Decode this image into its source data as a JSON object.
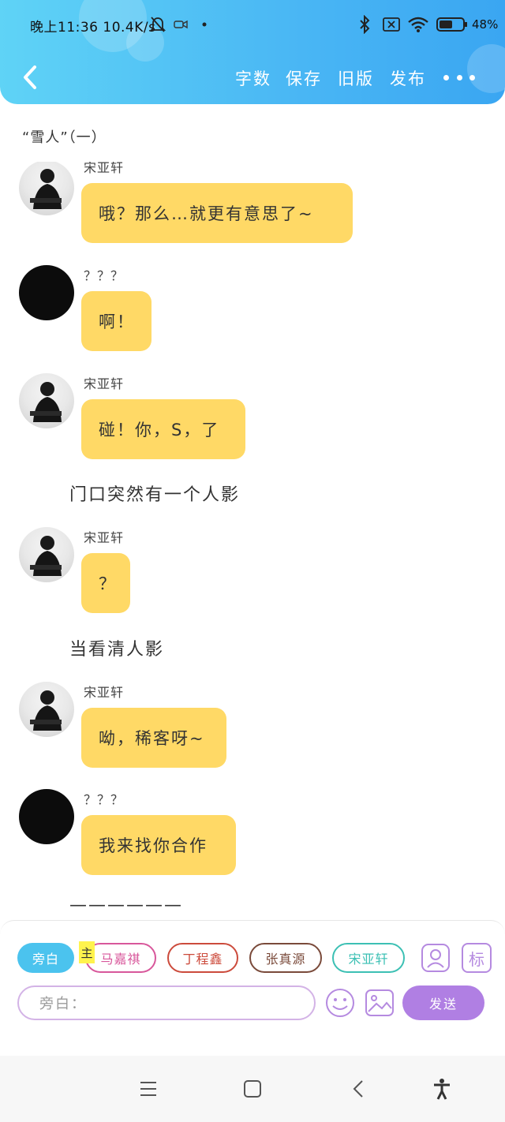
{
  "status_bar": {
    "time_and_speed": "晚上11:36 10.4K/s",
    "battery": "48%"
  },
  "toolbar": {
    "word_count": "字数",
    "save": "保存",
    "old_version": "旧版",
    "publish": "发布"
  },
  "chapter": {
    "title": "“雪人”（一）"
  },
  "feed": {
    "top_partial_speaker": "宋亚轩",
    "messages": [
      {
        "text": "哦？那么…就更有意思了~"
      },
      {
        "speaker": "？？？",
        "text": "啊！"
      },
      {
        "speaker": "宋亚轩",
        "text": "碰！你，S，了"
      },
      {
        "narration": "门口突然有一个人影"
      },
      {
        "speaker": "宋亚轩",
        "text": "？"
      },
      {
        "narration": "当看清人影"
      },
      {
        "speaker": "宋亚轩",
        "text": "呦，稀客呀~"
      },
      {
        "speaker": "？？？",
        "text": "我来找你合作"
      },
      {
        "narration": "——————"
      }
    ]
  },
  "composer": {
    "roles": [
      "旁白",
      "马嘉祺",
      "丁程鑫",
      "张真源",
      "宋亚轩"
    ],
    "main_tag": "主",
    "tag_button": "标",
    "input_placeholder": "旁白：",
    "send": "发送"
  },
  "colors": {
    "header_gradient_start": "#5fd3f6",
    "header_gradient_end": "#3aa6f2",
    "bubble": "#ffd966",
    "send": "#b07fe3",
    "role_majiaqi": "#d8579b",
    "role_dingchengxin": "#cc4b3c",
    "role_zhangzhenyuan": "#7a4a3a",
    "role_songyaxuan": "#3cc0b4"
  }
}
